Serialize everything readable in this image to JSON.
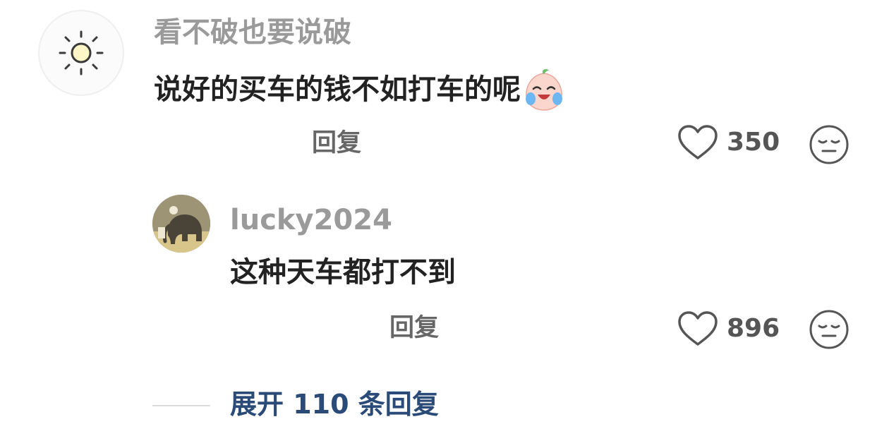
{
  "comment": {
    "username": "看不破也要说破",
    "text": "说好的买车的钱不如打车的呢",
    "emoji_icon": "crying-laughing-peach-emoji",
    "reply_label": "回复",
    "like_count": "350",
    "avatar_icon": "sun-icon"
  },
  "reply": {
    "username": "lucky2024",
    "text": "这种天车都打不到",
    "reply_label": "回复",
    "like_count": "896"
  },
  "expand": {
    "label": "展开 110 条回复"
  },
  "colors": {
    "username": "#9a9a9a",
    "text": "#222222",
    "expand_link": "#2a4a78",
    "icon_stroke": "#555555"
  }
}
